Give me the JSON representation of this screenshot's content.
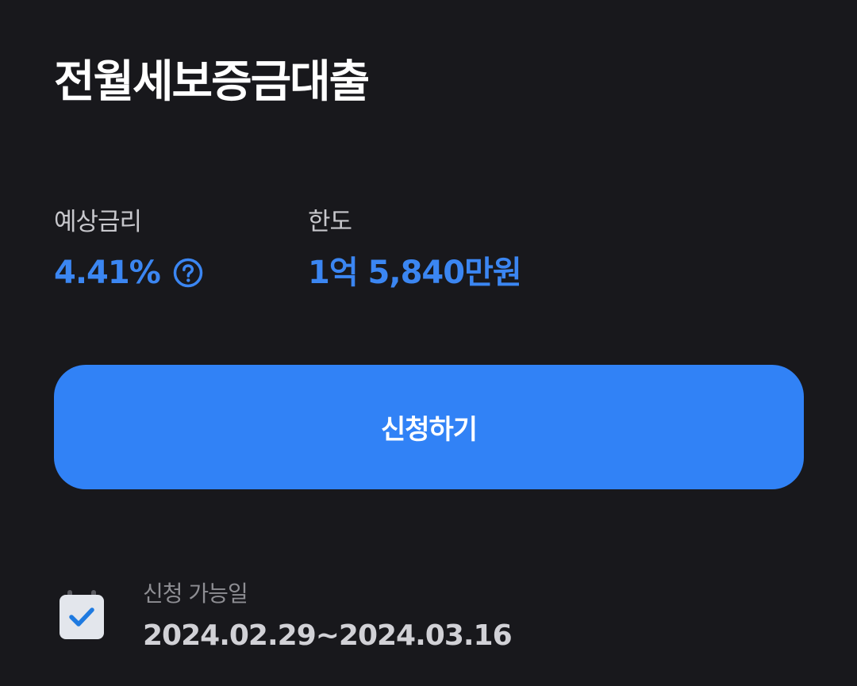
{
  "title": "전월세보증금대출",
  "rate": {
    "label": "예상금리",
    "value": "4.41%"
  },
  "limit": {
    "label": "한도",
    "value": "1억 5,840만원"
  },
  "apply_button": {
    "label": "신청하기"
  },
  "period": {
    "label": "신청 가능일",
    "range": "2024.02.29~2024.03.16"
  },
  "icons": {
    "help": "question-circle-icon",
    "calendar": "calendar-check-icon"
  },
  "colors": {
    "background": "#18181c",
    "accent": "#3182f6",
    "value_blue": "#3b86f2",
    "title": "#ffffff"
  }
}
